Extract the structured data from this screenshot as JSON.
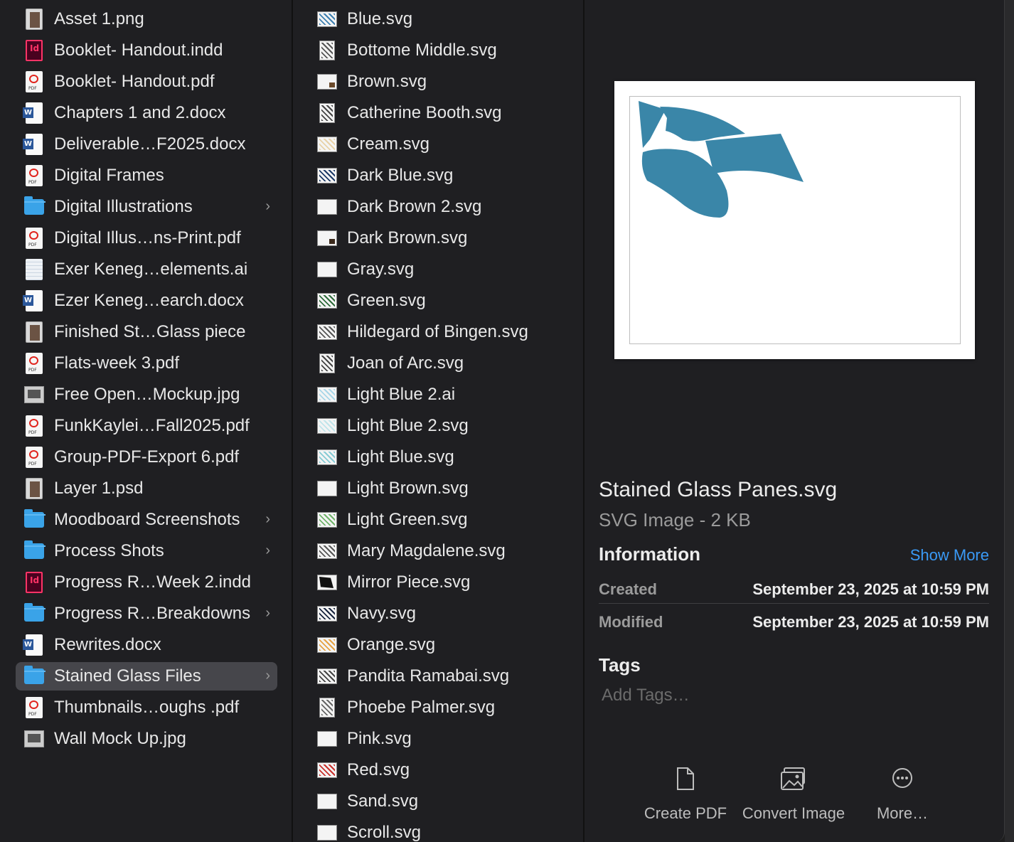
{
  "column1": [
    {
      "label": "Asset 1.png",
      "icon": "png-image-icon"
    },
    {
      "label": "Booklet- Handout.indd",
      "icon": "indesign-file-icon"
    },
    {
      "label": "Booklet- Handout.pdf",
      "icon": "pdf-file-icon"
    },
    {
      "label": "Chapters 1 and 2.docx",
      "icon": "word-file-icon"
    },
    {
      "label": "Deliverable…F2025.docx",
      "icon": "word-file-icon"
    },
    {
      "label": "Digital Frames",
      "icon": "pdf-file-icon"
    },
    {
      "label": "Digital Illustrations",
      "icon": "folder-icon",
      "folder": true
    },
    {
      "label": "Digital Illus…ns-Print.pdf",
      "icon": "pdf-file-icon"
    },
    {
      "label": "Exer Keneg…elements.ai",
      "icon": "illustrator-file-icon"
    },
    {
      "label": "Ezer Keneg…earch.docx",
      "icon": "word-file-icon"
    },
    {
      "label": "Finished St…Glass piece",
      "icon": "image-file-icon"
    },
    {
      "label": "Flats-week 3.pdf",
      "icon": "pdf-file-icon"
    },
    {
      "label": "Free Open…Mockup.jpg",
      "icon": "jpg-file-icon"
    },
    {
      "label": "FunkKaylei…Fall2025.pdf",
      "icon": "pdf-file-icon"
    },
    {
      "label": "Group-PDF-Export 6.pdf",
      "icon": "pdf-file-icon"
    },
    {
      "label": "Layer 1.psd",
      "icon": "psd-file-icon"
    },
    {
      "label": "Moodboard Screenshots",
      "icon": "folder-icon",
      "folder": true
    },
    {
      "label": "Process Shots",
      "icon": "folder-icon",
      "folder": true
    },
    {
      "label": "Progress R…Week 2.indd",
      "icon": "indesign-file-icon"
    },
    {
      "label": "Progress R…Breakdowns",
      "icon": "folder-icon",
      "folder": true
    },
    {
      "label": "Rewrites.docx",
      "icon": "word-file-icon"
    },
    {
      "label": "Stained Glass Files",
      "icon": "folder-icon",
      "folder": true,
      "selected": true
    },
    {
      "label": "Thumbnails…oughs .pdf",
      "icon": "pdf-file-icon"
    },
    {
      "label": "Wall Mock Up.jpg",
      "icon": "jpg-file-icon"
    }
  ],
  "column2": [
    {
      "label": "Blue.svg",
      "icon": "svg-thumbnail-icon",
      "color": "#3d7fb0"
    },
    {
      "label": "Bottome Middle.svg",
      "icon": "svg-thumbnail-icon",
      "color": "#555555"
    },
    {
      "label": "Brown.svg",
      "icon": "svg-thumbnail-icon",
      "color": "#6b4a2b"
    },
    {
      "label": "Catherine Booth.svg",
      "icon": "svg-thumbnail-icon",
      "color": "#444444"
    },
    {
      "label": "Cream.svg",
      "icon": "svg-thumbnail-icon",
      "color": "#e8d2a8"
    },
    {
      "label": "Dark Blue.svg",
      "icon": "svg-thumbnail-icon",
      "color": "#1d3a66"
    },
    {
      "label": "Dark Brown 2.svg",
      "icon": "svg-thumbnail-icon",
      "color": "#f4f4f4"
    },
    {
      "label": "Dark Brown.svg",
      "icon": "svg-thumbnail-icon",
      "color": "#3b2a1c"
    },
    {
      "label": "Gray.svg",
      "icon": "svg-thumbnail-icon",
      "color": "#f4f4f4"
    },
    {
      "label": "Green.svg",
      "icon": "svg-thumbnail-icon",
      "color": "#2e6b3a"
    },
    {
      "label": "Hildegard of Bingen.svg",
      "icon": "svg-thumbnail-icon",
      "color": "#555555"
    },
    {
      "label": "Joan of Arc.svg",
      "icon": "svg-thumbnail-icon",
      "color": "#444444"
    },
    {
      "label": "Light Blue 2.ai",
      "icon": "svg-thumbnail-icon",
      "color": "#a9d7e8"
    },
    {
      "label": "Light Blue 2.svg",
      "icon": "svg-thumbnail-icon",
      "color": "#bfe4ea"
    },
    {
      "label": "Light Blue.svg",
      "icon": "svg-thumbnail-icon",
      "color": "#86cbd4"
    },
    {
      "label": "Light Brown.svg",
      "icon": "svg-thumbnail-icon",
      "color": "#f4f4f4"
    },
    {
      "label": "Light Green.svg",
      "icon": "svg-thumbnail-icon",
      "color": "#6fb36a"
    },
    {
      "label": "Mary Magdalene.svg",
      "icon": "svg-thumbnail-icon",
      "color": "#555555"
    },
    {
      "label": "Mirror Piece.svg",
      "icon": "svg-thumbnail-icon",
      "color": "#111111"
    },
    {
      "label": "Navy.svg",
      "icon": "svg-thumbnail-icon",
      "color": "#1b2740"
    },
    {
      "label": "Orange.svg",
      "icon": "svg-thumbnail-icon",
      "color": "#e6a243"
    },
    {
      "label": "Pandita Ramabai.svg",
      "icon": "svg-thumbnail-icon",
      "color": "#444444"
    },
    {
      "label": "Phoebe Palmer.svg",
      "icon": "svg-thumbnail-icon",
      "color": "#666666"
    },
    {
      "label": "Pink.svg",
      "icon": "svg-thumbnail-icon",
      "color": "#f4f4f4"
    },
    {
      "label": "Red.svg",
      "icon": "svg-thumbnail-icon",
      "color": "#c9302c"
    },
    {
      "label": "Sand.svg",
      "icon": "svg-thumbnail-icon",
      "color": "#f4f4f4"
    },
    {
      "label": "Scroll.svg",
      "icon": "svg-thumbnail-icon",
      "color": "#f4f4f4"
    }
  ],
  "preview": {
    "filename": "Stained Glass Panes.svg",
    "kind": "SVG Image - 2 KB",
    "shape_color": "#3a86a8",
    "information_heading": "Information",
    "show_more": "Show More",
    "created_label": "Created",
    "created_value": "September 23, 2025 at 10:59 PM",
    "modified_label": "Modified",
    "modified_value": "September 23, 2025 at 10:59 PM",
    "tags_heading": "Tags",
    "tags_placeholder": "Add Tags…",
    "actions": [
      {
        "label": "Create PDF",
        "icon": "document-icon"
      },
      {
        "label": "Convert Image",
        "icon": "photos-icon"
      },
      {
        "label": "More…",
        "icon": "ellipsis-circle-icon"
      }
    ]
  },
  "accent": "#3a9af6",
  "selection_color": "#46464b"
}
